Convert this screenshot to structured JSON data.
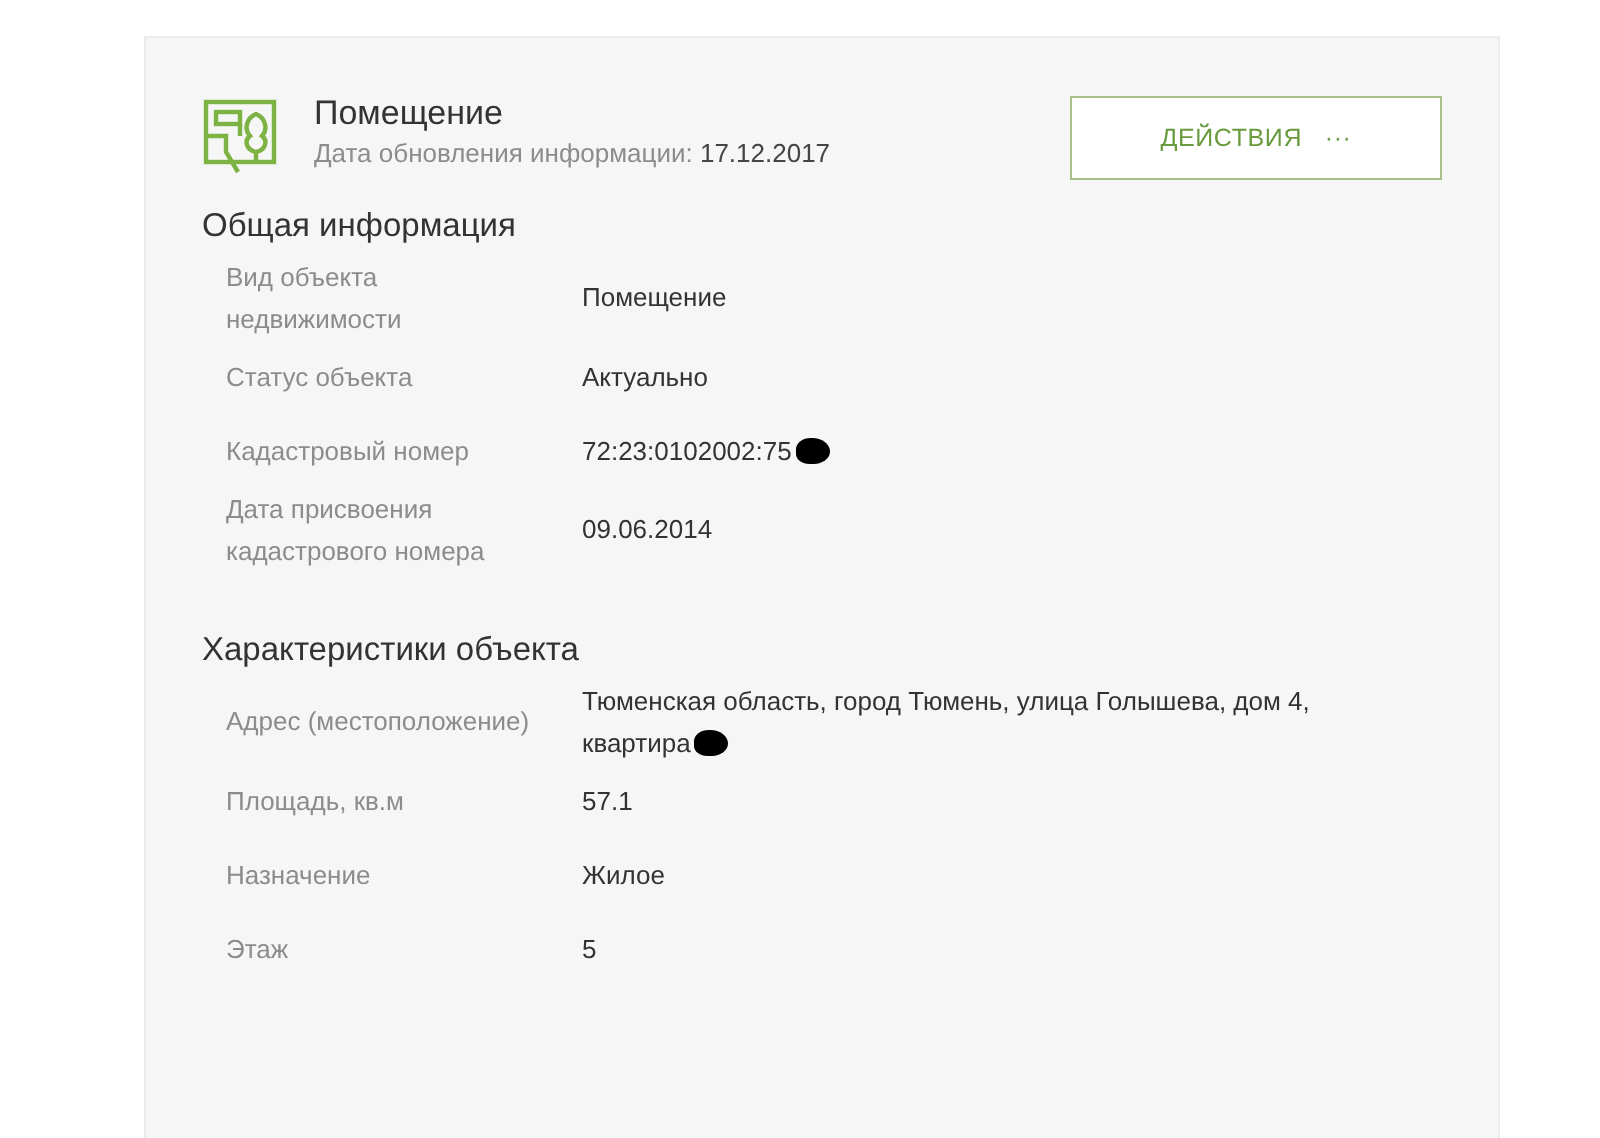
{
  "header": {
    "title": "Помещение",
    "updated_label": "Дата обновления информации:",
    "updated_value": "17.12.2017",
    "actions_button": {
      "label": "ДЕЙСТВИЯ",
      "icon": "···"
    }
  },
  "sections": [
    {
      "title": "Общая информация",
      "rows": [
        {
          "label": "Вид объекта недвижимости",
          "value": "Помещение",
          "redacted": false
        },
        {
          "label": "Статус объекта",
          "value": "Актуально",
          "redacted": false
        },
        {
          "label": "Кадастровый номер",
          "value": "72:23:0102002:75",
          "redacted": true
        },
        {
          "label": "Дата присвоения кадастрового номера",
          "value": "09.06.2014",
          "redacted": false
        }
      ]
    },
    {
      "title": "Характеристики объекта",
      "rows": [
        {
          "label": "Адрес (местоположение)",
          "value": "Тюменская область, город Тюмень, улица Голышева, дом 4, квартира",
          "redacted": true
        },
        {
          "label": "Площадь, кв.м",
          "value": "57.1",
          "redacted": false
        },
        {
          "label": "Назначение",
          "value": "Жилое",
          "redacted": false
        },
        {
          "label": "Этаж",
          "value": "5",
          "redacted": false
        }
      ]
    }
  ]
}
